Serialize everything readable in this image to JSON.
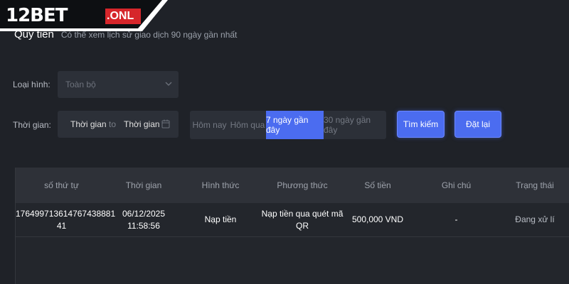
{
  "logo": {
    "text": "12BET",
    "suffix": ".ONL"
  },
  "header": {
    "title": "Quỹ tiền",
    "subtitle": "Có thể xem lịch sử giao dịch 90 ngày gần nhất"
  },
  "filters": {
    "type_label": "Loại hình:",
    "type_value": "Toàn bộ",
    "time_label": "Thời gian:",
    "start_placeholder": "Thời gian",
    "to_text": "to",
    "end_placeholder": "Thời gian",
    "quick_ranges": [
      "Hôm nay",
      "Hôm qua",
      "7 ngày gần đây",
      "30 ngày gần đây"
    ],
    "active_range": "7 ngày gần đây",
    "search_label": "Tìm kiếm",
    "reset_label": "Đặt lại"
  },
  "table": {
    "columns": [
      "số thứ tự",
      "Thời gian",
      "Hình thức",
      "Phương thức",
      "Số tiền",
      "Ghi chú",
      "Trạng thái"
    ],
    "rows": [
      {
        "id_line1": "176499713614767438881",
        "id_line2": "41",
        "time": "06/12/2025 11:58:56",
        "type": "Nạp tiền",
        "method_line1": "Nạp tiền qua quét mã",
        "method_line2": "QR",
        "amount": "500,000 VND",
        "note": "-",
        "status": "Đang xử lí"
      }
    ]
  },
  "colors": {
    "accent": "#4b6cf0",
    "brand_red": "#d6262b",
    "background": "#1f2228"
  }
}
